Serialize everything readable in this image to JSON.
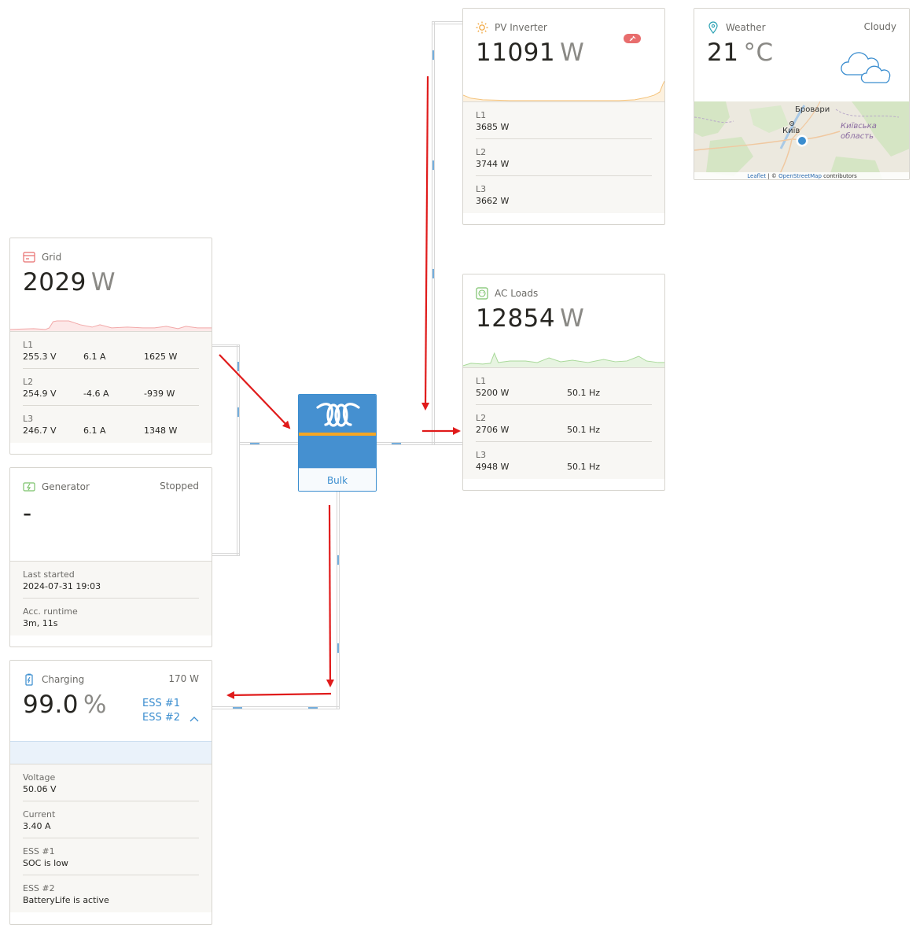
{
  "grid": {
    "title": "Grid",
    "value": "2029",
    "unit": "W",
    "icon": "grid-icon",
    "color": "#e86d6d",
    "phases": [
      {
        "label": "L1",
        "voltage": "255.3 V",
        "current": "6.1 A",
        "power": "1625 W"
      },
      {
        "label": "L2",
        "voltage": "254.9 V",
        "current": "-4.6 A",
        "power": "-939 W"
      },
      {
        "label": "L3",
        "voltage": "246.7 V",
        "current": "6.1 A",
        "power": "1348 W"
      }
    ]
  },
  "generator": {
    "title": "Generator",
    "status": "Stopped",
    "value": "-",
    "icon": "generator-icon",
    "rows": [
      {
        "label": "Last started",
        "value": "2024-07-31 19:03"
      },
      {
        "label": "Acc. runtime",
        "value": "3m, 11s"
      }
    ]
  },
  "battery": {
    "title": "Charging",
    "power": "170 W",
    "value": "99.0",
    "unit": "%",
    "icon": "battery-charging-icon",
    "ess_links": [
      "ESS #1",
      "ESS #2"
    ],
    "rows": [
      {
        "label": "Voltage",
        "value": "50.06 V"
      },
      {
        "label": "Current",
        "value": "3.40 A"
      },
      {
        "label": "ESS #1",
        "value": "SOC is low"
      },
      {
        "label": "ESS #2",
        "value": "BatteryLife is active"
      }
    ]
  },
  "inverter": {
    "state": "Bulk",
    "logo": "victron-logo",
    "color": "#4590d0"
  },
  "pv_inverter": {
    "title": "PV Inverter",
    "value": "11091",
    "unit": "W",
    "icon": "sun-icon",
    "badge_icon": "plug-badge-icon",
    "color": "#f0b35a",
    "phases": [
      {
        "label": "L1",
        "power": "3685 W"
      },
      {
        "label": "L2",
        "power": "3744 W"
      },
      {
        "label": "L3",
        "power": "3662 W"
      }
    ]
  },
  "ac_loads": {
    "title": "AC Loads",
    "value": "12854",
    "unit": "W",
    "icon": "outlet-icon",
    "color": "#7bc26a",
    "phases": [
      {
        "label": "L1",
        "power": "5200 W",
        "freq": "50.1 Hz"
      },
      {
        "label": "L2",
        "power": "2706 W",
        "freq": "50.1 Hz"
      },
      {
        "label": "L3",
        "power": "4948 W",
        "freq": "50.1 Hz"
      }
    ]
  },
  "weather": {
    "title": "Weather",
    "condition": "Cloudy",
    "value": "21",
    "unit": "°C",
    "icon": "location-pin-icon",
    "condition_icon": "cloud-icon",
    "map": {
      "labels": [
        "Бровари",
        "Київ",
        "Київська",
        "область"
      ],
      "attribution_leaflet": "Leaflet",
      "attribution_sep": "| ©",
      "attribution_osm": "OpenStreetMap",
      "attribution_tail": "contributors"
    }
  }
}
